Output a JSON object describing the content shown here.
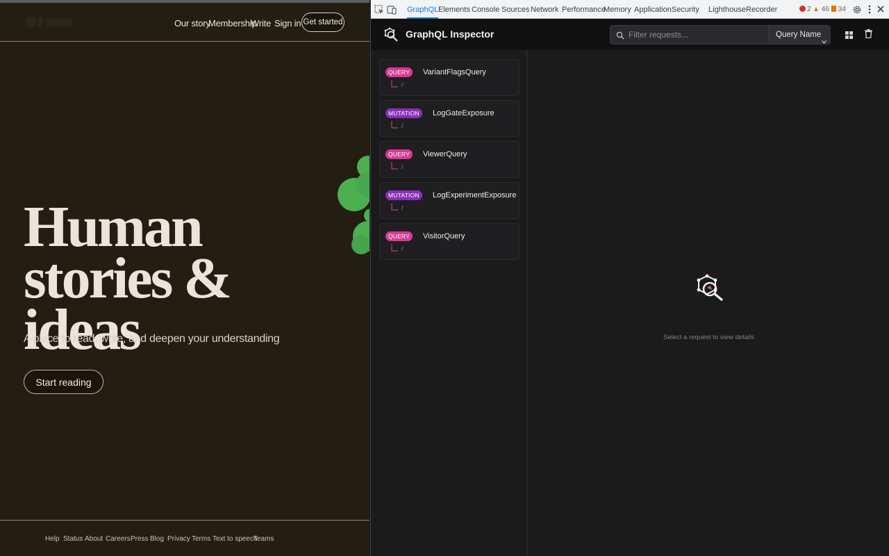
{
  "site": {
    "nav": [
      "Our story",
      "Membership",
      "Write",
      "Sign in"
    ],
    "get_started": "Get started",
    "hero_line1": "Human",
    "hero_line2": "stories & ideas",
    "subtitle": "A place to read, write, and deepen your understanding",
    "start_reading": "Start reading",
    "footer": [
      "Help",
      "Status",
      "About",
      "Careers",
      "Press",
      "Blog",
      "Privacy",
      "Terms",
      "Text to speech",
      "Teams"
    ],
    "colors": {
      "background": "#241d12",
      "text": "#e9e4dc",
      "clover": "#4caf50"
    }
  },
  "devtools": {
    "tabs": [
      "GraphQL",
      "Elements",
      "Console",
      "Sources",
      "Network",
      "Performance",
      "Memory",
      "Application",
      "Security",
      "Lighthouse",
      "Recorder"
    ],
    "active_tab": "GraphQL",
    "errors": "2",
    "warnings": "46",
    "issues": "34",
    "icons": [
      "inspect-element-icon",
      "device-toolbar-icon",
      "settings-gear-icon",
      "kebab-menu-icon",
      "close-icon"
    ]
  },
  "inspector": {
    "title": "GraphQL Inspector",
    "search_placeholder": "Filter requests...",
    "filter_select": "Query Name",
    "requests": [
      {
        "type": "QUERY",
        "name": "VariantFlagsQuery",
        "path": "/"
      },
      {
        "type": "MUTATION",
        "name": "LogGateExposure",
        "path": "/"
      },
      {
        "type": "QUERY",
        "name": "ViewerQuery",
        "path": "/"
      },
      {
        "type": "MUTATION",
        "name": "LogExperimentExposure",
        "path": "/"
      },
      {
        "type": "QUERY",
        "name": "VisitorQuery",
        "path": "/"
      }
    ],
    "empty_state": "Select a request to view details",
    "colors": {
      "query_badge": "#d63a96",
      "mutation_badge": "#8a2fb8",
      "accent_tab": "#1a73e8"
    }
  }
}
